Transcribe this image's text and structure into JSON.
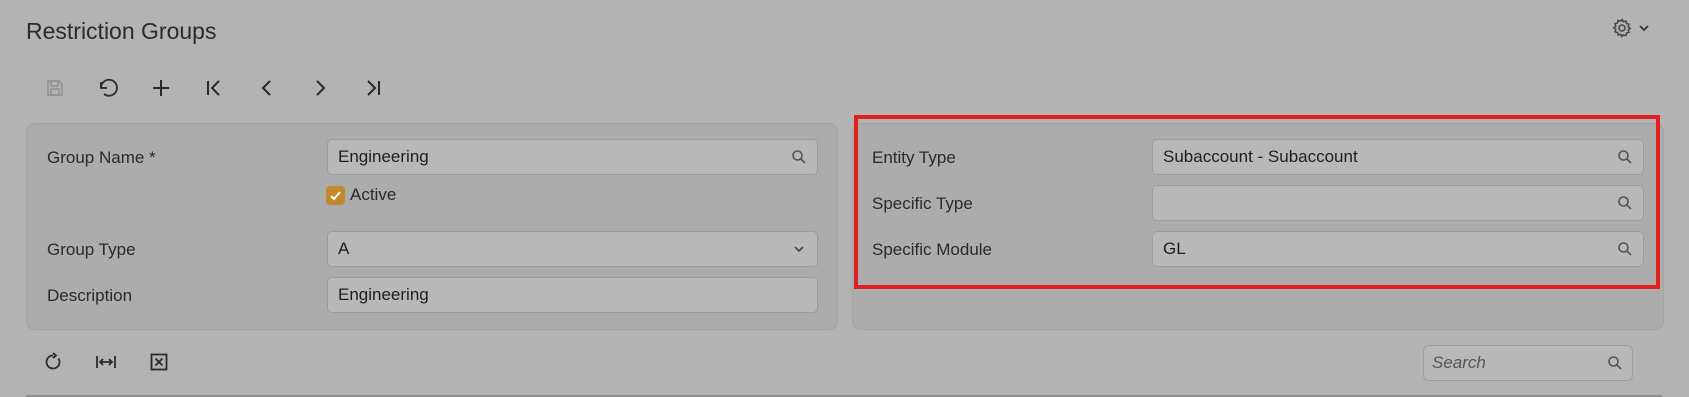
{
  "page": {
    "title": "Restriction Groups"
  },
  "toolbar": {
    "buttons": [
      {
        "name": "save-button",
        "icon": "save-icon",
        "enabled": false
      },
      {
        "name": "undo-button",
        "icon": "undo-icon",
        "enabled": true
      },
      {
        "name": "add-button",
        "icon": "plus-icon",
        "enabled": true
      },
      {
        "name": "first-record-button",
        "icon": "first-icon",
        "enabled": true
      },
      {
        "name": "previous-record-button",
        "icon": "previous-icon",
        "enabled": true
      },
      {
        "name": "next-record-button",
        "icon": "next-icon",
        "enabled": true
      },
      {
        "name": "last-record-button",
        "icon": "last-icon",
        "enabled": true
      }
    ]
  },
  "form_left": {
    "group_name_label": "Group Name *",
    "group_name_value": "Engineering",
    "active_label": "Active",
    "active_checked": true,
    "group_type_label": "Group Type",
    "group_type_value": "A",
    "description_label": "Description",
    "description_value": "Engineering"
  },
  "form_right": {
    "entity_type_label": "Entity Type",
    "entity_type_value": "Subaccount - Subaccount",
    "specific_type_label": "Specific Type",
    "specific_type_value": "",
    "specific_module_label": "Specific Module",
    "specific_module_value": "GL"
  },
  "grid_toolbar": {
    "buttons": [
      {
        "name": "refresh-button",
        "icon": "refresh-icon"
      },
      {
        "name": "fit-columns-button",
        "icon": "fit-width-icon"
      },
      {
        "name": "export-excel-button",
        "icon": "excel-icon"
      }
    ],
    "search_placeholder": "Search"
  },
  "colors": {
    "background": "#b3b3b3",
    "checkbox_accent": "#c0892a",
    "highlight": "#e02020"
  }
}
